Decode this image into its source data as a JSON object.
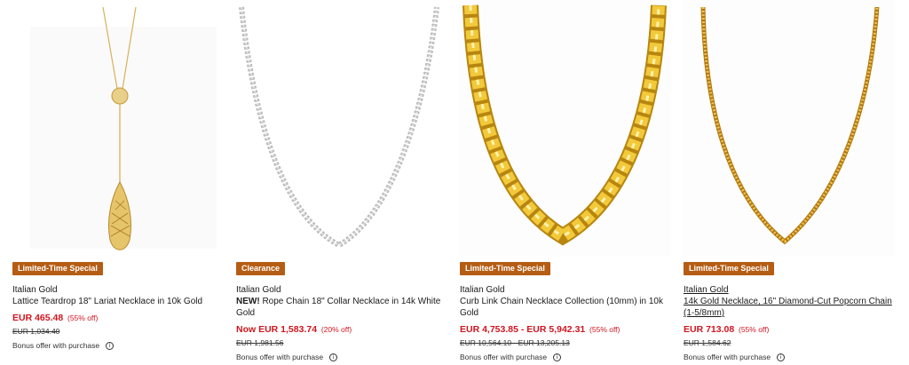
{
  "products": [
    {
      "badge": "Limited-Time Special",
      "brand": "Italian Gold",
      "name": "Lattice Teardrop 18\" Lariat Necklace in 10k Gold",
      "price_prefix": "",
      "price": "EUR 465.48",
      "discount": "(55% off)",
      "original_price": "EUR 1,034.40",
      "bonus": "Bonus offer with purchase",
      "image_icon": "gold-lariat-necklace-image"
    },
    {
      "badge": "Clearance",
      "brand": "Italian Gold",
      "name_new_tag": "NEW!",
      "name": " Rope Chain 18\" Collar Necklace in 14k White Gold",
      "price_prefix": "Now ",
      "price": "EUR 1,583.74",
      "discount": "(20% off)",
      "original_price": "EUR 1,981.56",
      "bonus": "Bonus offer with purchase",
      "image_icon": "white-gold-rope-chain-image"
    },
    {
      "badge": "Limited-Time Special",
      "brand": "Italian Gold",
      "name": "Curb Link Chain Necklace Collection (10mm) in 10k Gold",
      "price_prefix": "",
      "price": "EUR 4,753.85 - EUR 5,942.31",
      "discount": "(55% off)",
      "original_price": "EUR 10,564.10 - EUR 13,205.13",
      "bonus": "Bonus offer with purchase",
      "image_icon": "gold-curb-chain-image"
    },
    {
      "badge": "Limited-Time Special",
      "brand": "Italian Gold",
      "name": "14k Gold Necklace, 16\" Diamond-Cut Popcorn Chain (1-5/8mm)",
      "price_prefix": "",
      "price": "EUR 713.08",
      "discount": "(55% off)",
      "original_price": "EUR 1,584.62",
      "bonus": "Bonus offer with purchase",
      "image_icon": "gold-popcorn-chain-image"
    }
  ],
  "colors": {
    "badge_bg": "#b55d14",
    "sale_red": "#d0151f",
    "gold": "#d8a422",
    "silver": "#c9c9c9"
  },
  "info_icon_glyph": "i"
}
